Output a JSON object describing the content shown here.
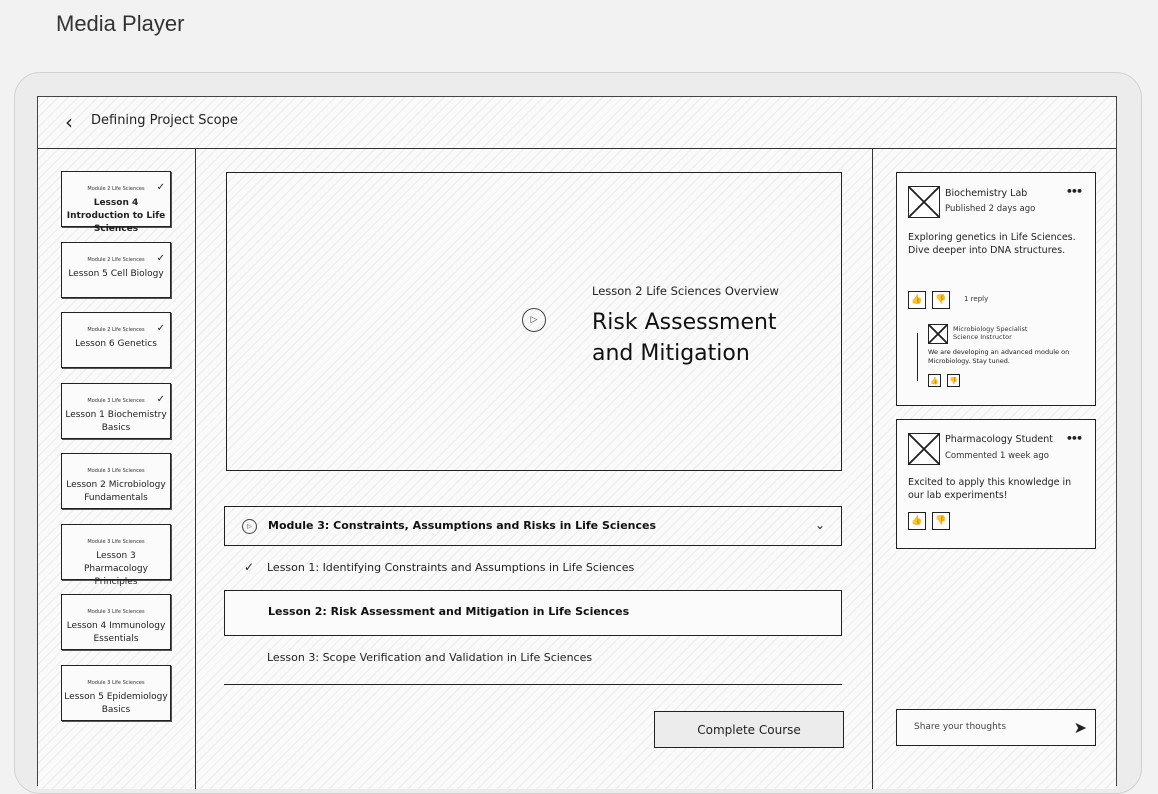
{
  "page_title": "Media Player",
  "header": {
    "title": "Defining Project Scope",
    "back_icon": "‹"
  },
  "lesson_cards": [
    {
      "module": "Module 2 Life Sciences",
      "title": "Lesson 4 Introduction to Life Sciences",
      "completed": true,
      "active": true
    },
    {
      "module": "Module 2 Life Sciences",
      "title": "Lesson 5 Cell Biology",
      "completed": true,
      "active": false
    },
    {
      "module": "Module 2 Life Sciences",
      "title": "Lesson 6 Genetics",
      "completed": true,
      "active": false
    },
    {
      "module": "Module 3 Life Sciences",
      "title": "Lesson 1 Biochemistry Basics",
      "completed": true,
      "active": false
    },
    {
      "module": "Module 3 Life Sciences",
      "title": "Lesson 2 Microbiology Fundamentals",
      "completed": false,
      "active": false
    },
    {
      "module": "Module 3 Life Sciences",
      "title": "Lesson 3 Pharmacology Principles",
      "completed": false,
      "active": false
    },
    {
      "module": "Module 3 Life Sciences",
      "title": "Lesson 4 Immunology Essentials",
      "completed": false,
      "active": false
    },
    {
      "module": "Module 3 Life Sciences",
      "title": "Lesson 5 Epidemiology Basics",
      "completed": false,
      "active": false
    }
  ],
  "video": {
    "subtitle": "Lesson 2 Life Sciences Overview",
    "title": "Risk Assessment and Mitigation",
    "play_icon": "▷"
  },
  "module_section": {
    "title": "Module 3: Constraints, Assumptions and Risks in Life Sciences",
    "chevron": "⌄",
    "lessons": [
      {
        "title": "Lesson 1: Identifying Constraints and Assumptions in Life Sciences",
        "completed": true,
        "selected": false
      },
      {
        "title": "Lesson 2: Risk Assessment and Mitigation in Life Sciences",
        "completed": false,
        "selected": true
      },
      {
        "title": "Lesson 3: Scope Verification and Validation in Life Sciences",
        "completed": false,
        "selected": false
      }
    ]
  },
  "complete_button": "Complete Course",
  "comments": [
    {
      "author": "Biochemistry Lab",
      "meta": "Published 2 days ago",
      "text": "Exploring genetics in Life Sciences. Dive deeper into DNA structures.",
      "reply_count": "1 reply",
      "reply": {
        "author": "Microbiology Specialist",
        "role": "Science Instructor",
        "text": "We are developing an advanced module on Microbiology. Stay tuned."
      }
    },
    {
      "author": "Pharmacology Student",
      "meta": "Commented 1 week ago",
      "text": "Excited to apply this knowledge in our lab experiments!"
    }
  ],
  "comment_input": {
    "placeholder": "Share your thoughts"
  },
  "icons": {
    "check": "✓",
    "thumb_up": "👍",
    "thumb_down": "👎",
    "send": "➤",
    "more": "•••"
  }
}
